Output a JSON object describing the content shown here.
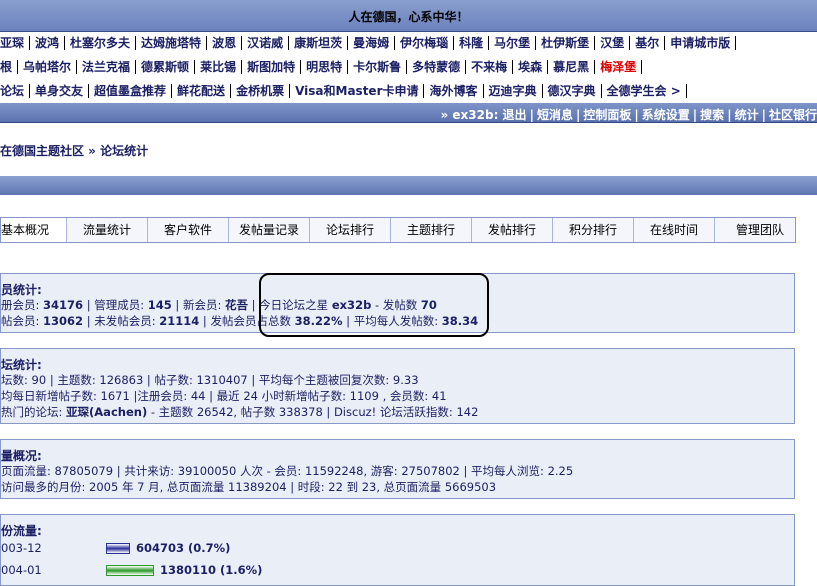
{
  "header": {
    "title": "人在德国，心系中华！"
  },
  "city_rows": [
    [
      "亚琛",
      "波鸿",
      "杜塞尔多夫",
      "达姆施塔特",
      "波恩",
      "汉诺威",
      "康斯坦茨",
      "曼海姆",
      "伊尔梅瑙",
      "科隆",
      "马尔堡",
      "杜伊斯堡",
      "汉堡",
      "基尔",
      "申请城市版"
    ],
    [
      "根",
      "乌帕塔尔",
      "法兰克福",
      "德累斯顿",
      "莱比锡",
      "斯图加特",
      "明思特",
      "卡尔斯鲁",
      "多特蒙德",
      "不来梅",
      "埃森",
      "慕尼黑",
      "梅泽堡"
    ],
    [
      "论坛",
      "单身交友",
      "超值墨盒推荐",
      "鲜花配送",
      "金桥机票",
      "Visa和Master卡申请",
      "海外博客",
      "迈迪字典",
      "德汉字典",
      "全德学生会 >"
    ]
  ],
  "hot_city": "梅泽堡",
  "userbar": {
    "links": [
      "» ex32b: 退出",
      "短消息",
      "控制面板",
      "系统设置",
      "搜索",
      "统计",
      "社区银行"
    ]
  },
  "breadcrumb": "在德国主题社区 » 论坛统计",
  "tabs": [
    "基本概况",
    "流量统计",
    "客户软件",
    "发帖量记录",
    "论坛排行",
    "主题排行",
    "发帖排行",
    "积分排行",
    "在线时间",
    "管理团队"
  ],
  "member_stats": {
    "heading": "员统计:",
    "line1_a": "册会员: ",
    "total_members": "34176",
    "line1_b": " | 管理成员: ",
    "admins": "145",
    "line1_c": " | 新会员: ",
    "new_member": "花吾",
    "line1_d": " | 今日论坛之星 ",
    "star": "ex32b",
    "line1_e": " - 发帖数 ",
    "star_posts": "70",
    "line2_a": "帖会员: ",
    "posting_members": "13062",
    "line2_b": " | 未发帖会员: ",
    "non_posting": "21114",
    "line2_c": " | 发帖会员占总数 ",
    "ratio": "38.22%",
    "line2_d": " | 平均每人发帖数: ",
    "avg_posts": "38.34"
  },
  "forum_stats": {
    "heading": "坛统计:",
    "line1": "坛数: 90 | 主题数: 126863 | 帖子数: 1310407 | 平均每个主题被回复次数: 9.33",
    "line2": "均每日新增帖子数: 1671 |注册会员: 44 | 最近 24 小时新增帖子数: 1109 , 会员数: 41",
    "line3_a": "热门的论坛: ",
    "hot_forum": "亚琛(Aachen)",
    "line3_b": " - 主题数 26542, 帖子数 338378 | Discuz! 论坛活跃指数: 142"
  },
  "traffic": {
    "heading": "量概况:",
    "line1": "页面流量: 87805079 | 共计来访: 39100050 人次 - 会员: 11592248, 游客: 27507802 | 平均每人浏览: 2.25",
    "line2": "访问最多的月份: 2005 年 7 月, 总页面流量 11389204 | 时段: 22 到 23, 总页面流量 5669503"
  },
  "monthly": {
    "heading": "份流量:",
    "rows": [
      {
        "month": "003-12",
        "value": "604703 (0.7%)",
        "color": "#2a2f9a"
      },
      {
        "month": "004-01",
        "value": "1380110 (1.6%)",
        "color": "#2e9a2a"
      }
    ]
  }
}
